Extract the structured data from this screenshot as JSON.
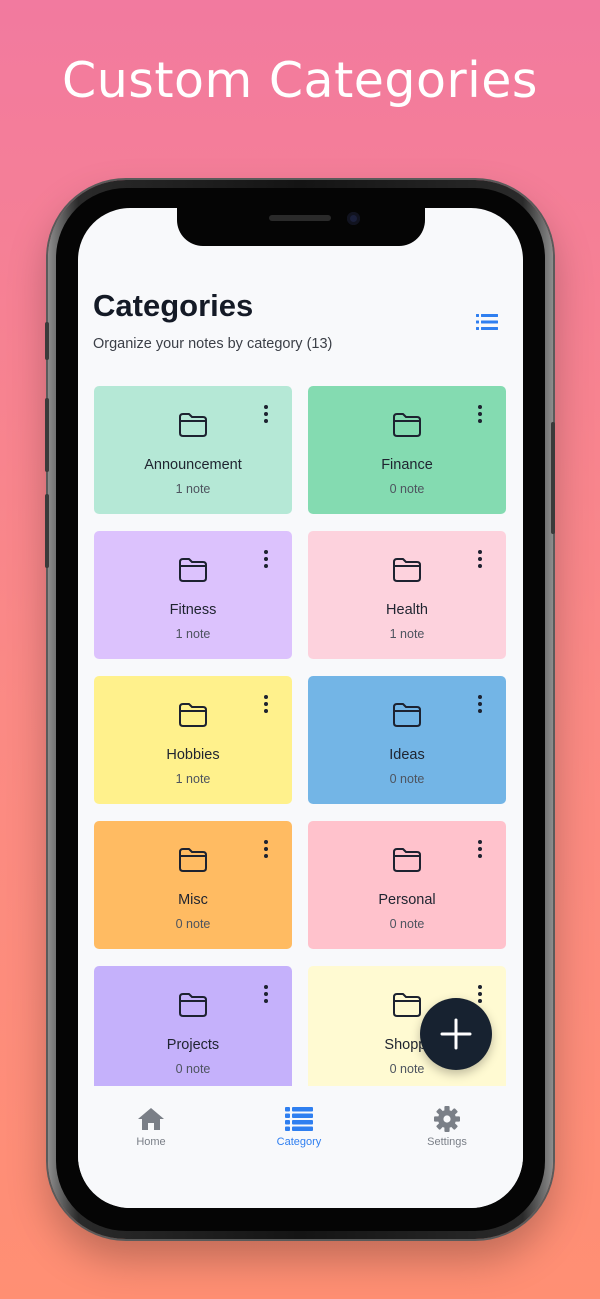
{
  "headline": "Custom Categories",
  "header": {
    "title": "Categories",
    "subtitle": "Organize your notes by category (13)"
  },
  "colors": {
    "accent": "#2f7ff0",
    "fab": "#172230"
  },
  "categories": [
    {
      "name": "Announcement",
      "count": "1 note",
      "color": "#b5e8d6"
    },
    {
      "name": "Finance",
      "count": "0 note",
      "color": "#84dbb1"
    },
    {
      "name": "Fitness",
      "count": "1 note",
      "color": "#dcc2fd"
    },
    {
      "name": "Health",
      "count": "1 note",
      "color": "#fdd2dd"
    },
    {
      "name": "Hobbies",
      "count": "1 note",
      "color": "#fff18c"
    },
    {
      "name": "Ideas",
      "count": "0 note",
      "color": "#73b5e6"
    },
    {
      "name": "Misc",
      "count": "0 note",
      "color": "#ffbb62"
    },
    {
      "name": "Personal",
      "count": "0 note",
      "color": "#ffc2cc"
    },
    {
      "name": "Projects",
      "count": "0 note",
      "color": "#c5b1fb"
    },
    {
      "name": "Shoppi",
      "count": "0 note",
      "color": "#fffad2"
    }
  ],
  "tabs": [
    {
      "label": "Home",
      "icon": "home-icon"
    },
    {
      "label": "Category",
      "icon": "list-icon"
    },
    {
      "label": "Settings",
      "icon": "gear-icon"
    }
  ],
  "fab_icon": "plus-icon"
}
